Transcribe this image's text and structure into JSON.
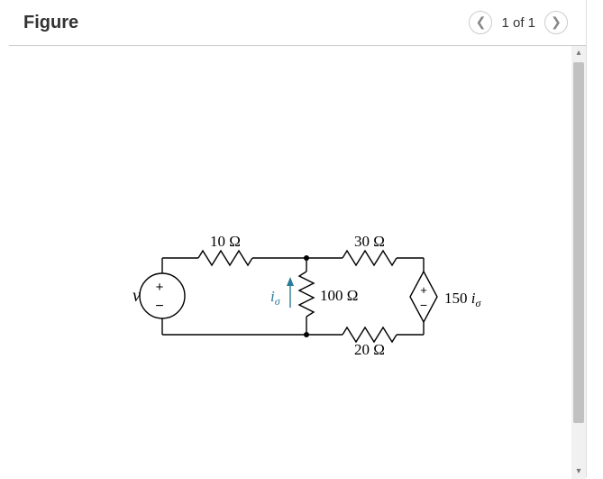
{
  "header": {
    "title": "Figure",
    "pager": "1 of 1"
  },
  "circuit": {
    "source_label": "v",
    "r1": {
      "value": "10 Ω"
    },
    "r2": {
      "value": "30 Ω"
    },
    "r3": {
      "value": "100 Ω"
    },
    "r4": {
      "value": "20 Ω"
    },
    "i_sigma": "i",
    "i_sigma_sub": "σ",
    "dep_source": {
      "gain": "150 ",
      "var": "i",
      "sub": "σ"
    }
  }
}
